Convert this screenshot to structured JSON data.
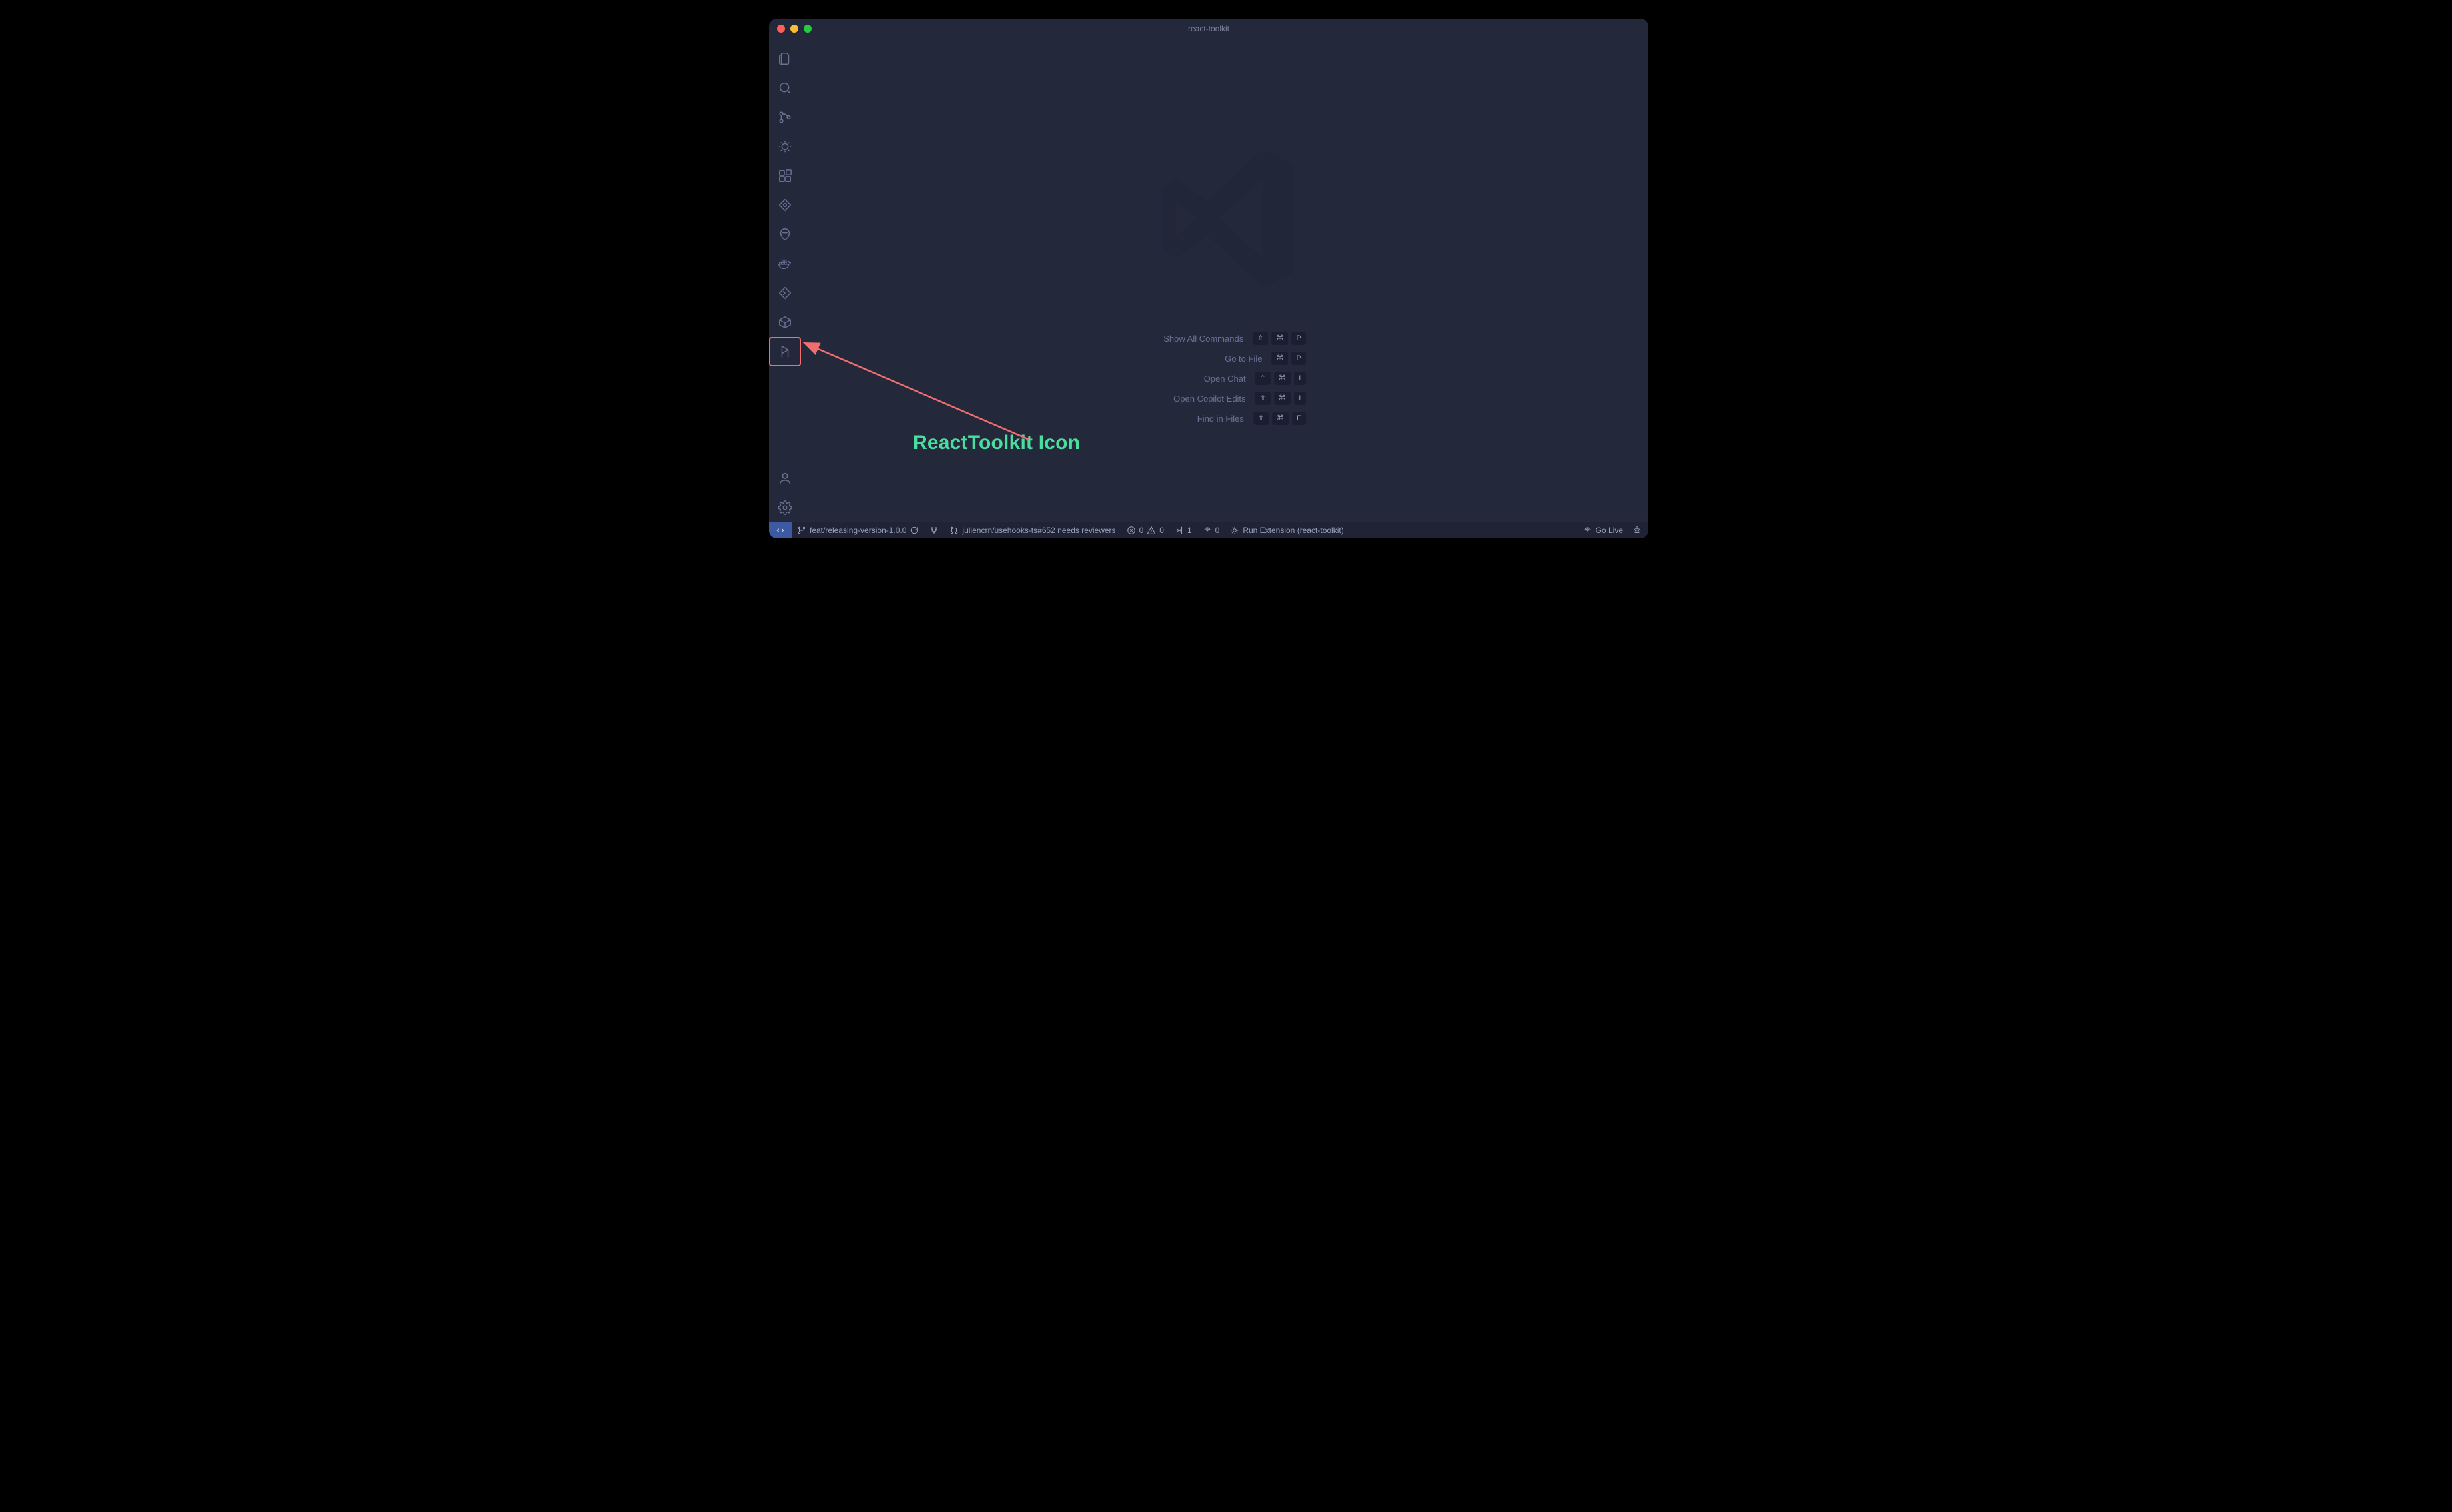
{
  "window": {
    "title": "react-toolkit"
  },
  "activitybar": {
    "items": [
      {
        "name": "explorer-icon"
      },
      {
        "name": "search-icon"
      },
      {
        "name": "source-control-icon"
      },
      {
        "name": "run-debug-icon"
      },
      {
        "name": "extensions-icon"
      },
      {
        "name": "git-graph-icon"
      },
      {
        "name": "copilot-icon"
      },
      {
        "name": "docker-icon"
      },
      {
        "name": "remote-explorer-icon"
      },
      {
        "name": "package-icon"
      },
      {
        "name": "react-toolkit-icon"
      }
    ],
    "bottom": [
      {
        "name": "accounts-icon"
      },
      {
        "name": "settings-icon"
      }
    ]
  },
  "welcome": {
    "actions": [
      {
        "label": "Show All Commands",
        "keys": [
          "⇧",
          "⌘",
          "P"
        ]
      },
      {
        "label": "Go to File",
        "keys": [
          "⌘",
          "P"
        ]
      },
      {
        "label": "Open Chat",
        "keys": [
          "⌃",
          "⌘",
          "I"
        ]
      },
      {
        "label": "Open Copilot Edits",
        "keys": [
          "⇧",
          "⌘",
          "I"
        ]
      },
      {
        "label": "Find in Files",
        "keys": [
          "⇧",
          "⌘",
          "F"
        ]
      }
    ]
  },
  "statusbar": {
    "branch": "feat/releasing-version-1.0.0",
    "pr": "juliencrn/usehooks-ts#652 needs reviewers",
    "errors": "0",
    "warnings": "0",
    "conflicts": "1",
    "ports": "0",
    "runner": "Run Extension (react-toolkit)",
    "golive": "Go Live"
  },
  "annotation": {
    "label": "ReactToolkit Icon"
  }
}
